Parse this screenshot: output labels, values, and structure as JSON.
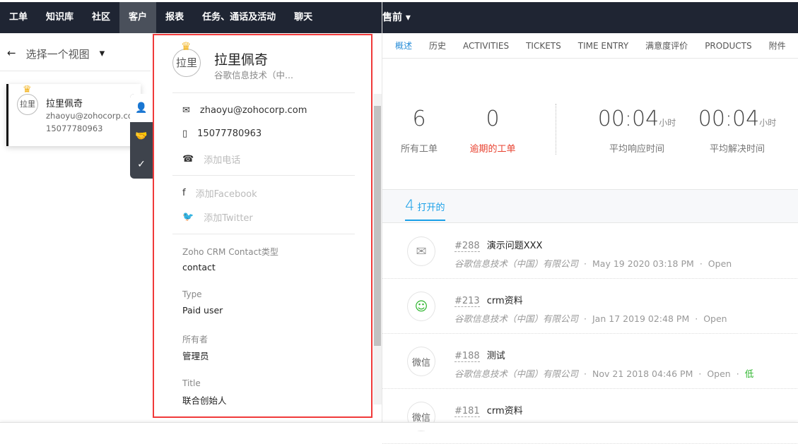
{
  "nav": {
    "items": [
      "工单",
      "知识库",
      "社区",
      "客户",
      "报表",
      "任务、通话及活动",
      "聊天"
    ],
    "active": 3,
    "right": "售前"
  },
  "left": {
    "view_label": "选择一个视图",
    "card": {
      "avatar": "拉里",
      "name": "拉里佩奇",
      "email": "zhaoyu@zohocorp.co...",
      "phone": "15077780963"
    }
  },
  "detail": {
    "avatar": "拉里",
    "name": "拉里佩奇",
    "company": "谷歌信息技术（中...",
    "email": "zhaoyu@zohocorp.com",
    "mobile": "15077780963",
    "add_phone": "添加电话",
    "add_facebook": "添加Facebook",
    "add_twitter": "添加Twitter",
    "fields": [
      {
        "label": "Zoho CRM Contact类型",
        "value": "contact"
      },
      {
        "label": "Type",
        "value": "Paid user"
      },
      {
        "label": "所有者",
        "value": "管理员"
      },
      {
        "label": "Title",
        "value": "联合创始人"
      }
    ]
  },
  "tabs": [
    "概述",
    "历史",
    "ACTIVITIES",
    "TICKETS",
    "TIME ENTRY",
    "满意度评价",
    "PRODUCTS",
    "附件"
  ],
  "stats": {
    "all": {
      "value": "6",
      "label": "所有工单"
    },
    "overdue": {
      "value": "0",
      "label": "逾期的工单"
    },
    "response": {
      "value": "00:04",
      "unit": "小时",
      "label": "平均响应时间"
    },
    "resolution": {
      "value": "00:04",
      "unit": "小时",
      "label": "平均解决时间"
    }
  },
  "open": {
    "count": "4",
    "label": "打开的"
  },
  "tickets": [
    {
      "icon": "mail",
      "num": "#288",
      "subject": "演示问题XXX",
      "company": "谷歌信息技术（中国）有限公司",
      "date": "May 19 2020 03:18 PM",
      "status": "Open",
      "priority": ""
    },
    {
      "icon": "feedback",
      "num": "#213",
      "subject": "crm资料",
      "company": "谷歌信息技术（中国）有限公司",
      "date": "Jan 17 2019 02:48 PM",
      "status": "Open",
      "priority": ""
    },
    {
      "icon": "微信",
      "num": "#188",
      "subject": "测试",
      "company": "谷歌信息技术（中国）有限公司",
      "date": "Nov 21 2018 04:46 PM",
      "status": "Open",
      "priority": "低"
    },
    {
      "icon": "微信",
      "num": "#181",
      "subject": "crm资料",
      "company": "",
      "date": "",
      "status": "",
      "priority": ""
    }
  ],
  "colors": {
    "nav": "#1f2533",
    "accent": "#1aa0e8",
    "highlight_border": "#f03a3a",
    "overdue": "#e8412f",
    "low": "#2cb52c"
  }
}
